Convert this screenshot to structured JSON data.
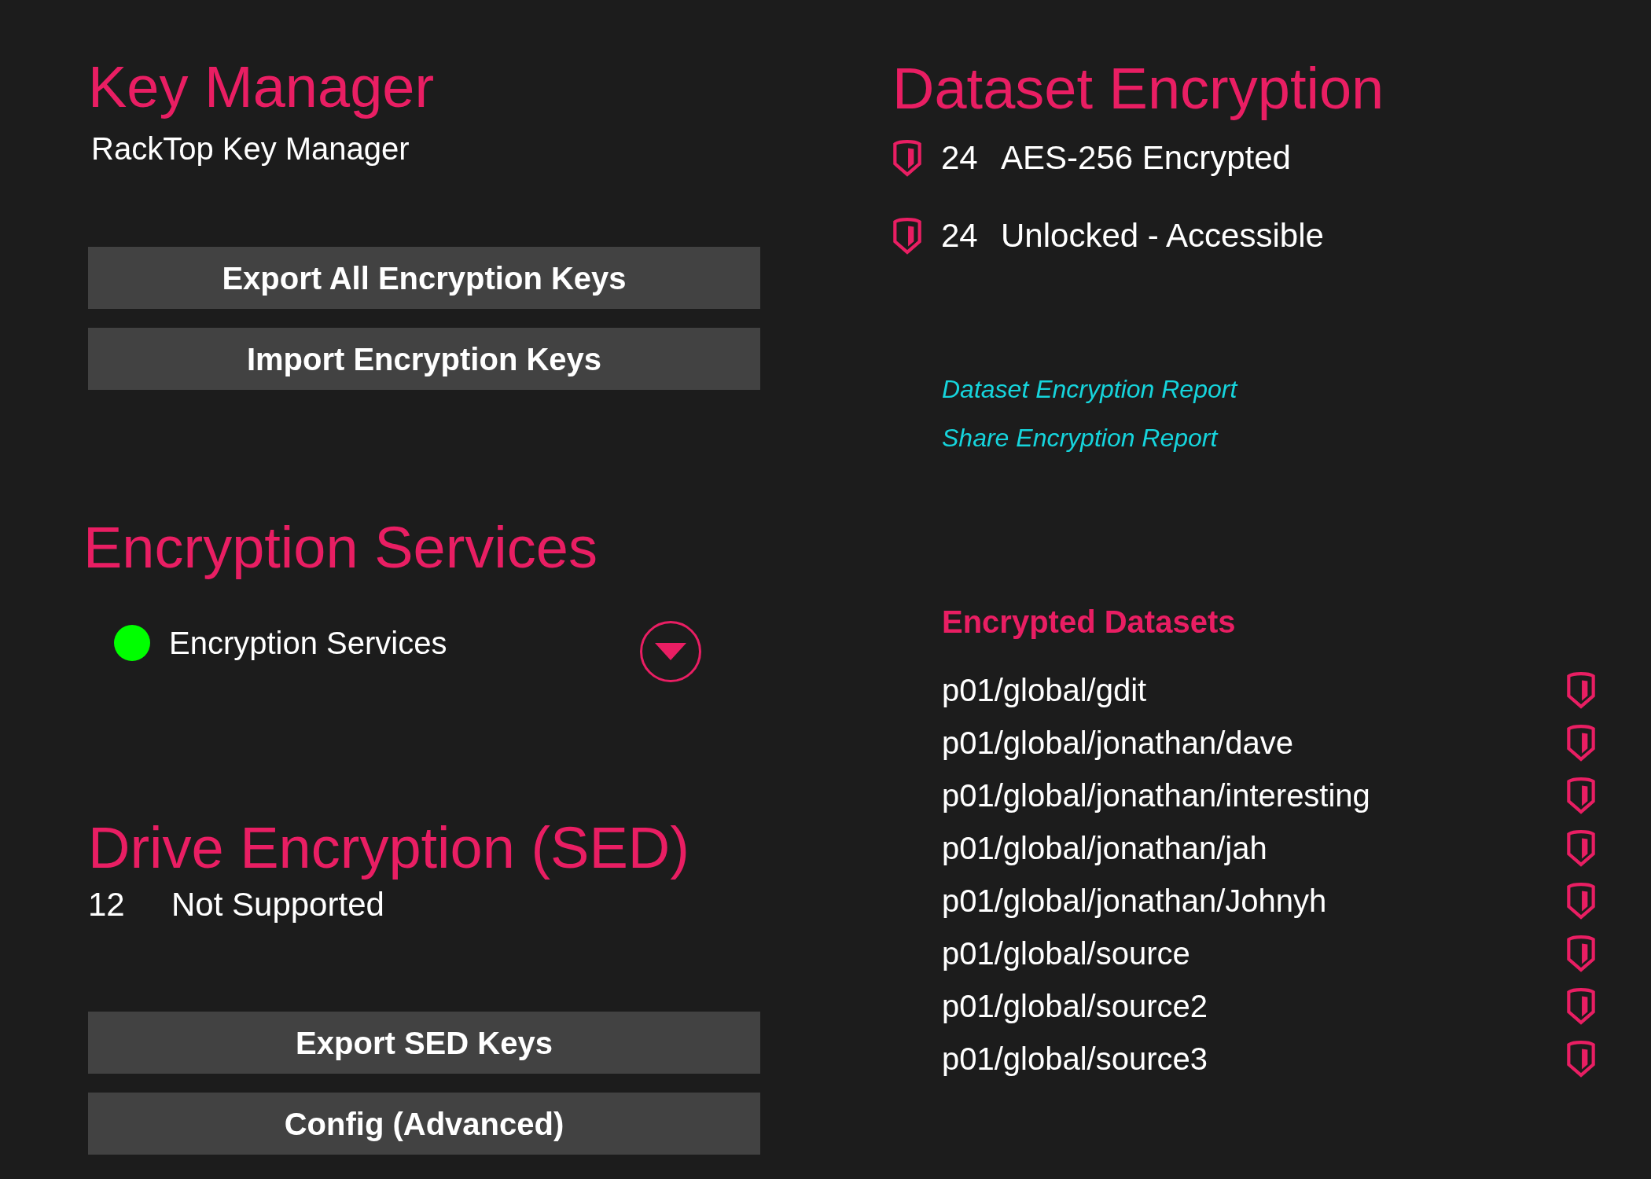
{
  "key_manager": {
    "title": "Key Manager",
    "subtitle": "RackTop Key Manager",
    "buttons": [
      "Export All Encryption Keys",
      "Import Encryption Keys"
    ]
  },
  "encryption_services": {
    "title": "Encryption Services",
    "services": [
      {
        "name": "Encryption Services",
        "on": true,
        "expanded": false
      }
    ]
  },
  "drive_encryption": {
    "title": "Drive Encryption (SED)",
    "count": "12",
    "status": "Not Supported",
    "buttons": [
      "Export SED Keys",
      "Config (Advanced)"
    ]
  },
  "dataset_encryption": {
    "title": "Dataset Encryption",
    "stats": [
      {
        "count": "24",
        "label": "AES-256 Encrypted"
      },
      {
        "count": "24",
        "label": "Unlocked - Accessible"
      }
    ],
    "links": [
      "Dataset Encryption Report",
      "Share Encryption Report"
    ],
    "datasets_heading": "Encrypted Datasets",
    "datasets": [
      "p01/global/gdit",
      "p01/global/jonathan/dave",
      "p01/global/jonathan/interesting",
      "p01/global/jonathan/jah",
      "p01/global/jonathan/Johnyh",
      "p01/global/source",
      "p01/global/source2",
      "p01/global/source3"
    ]
  }
}
